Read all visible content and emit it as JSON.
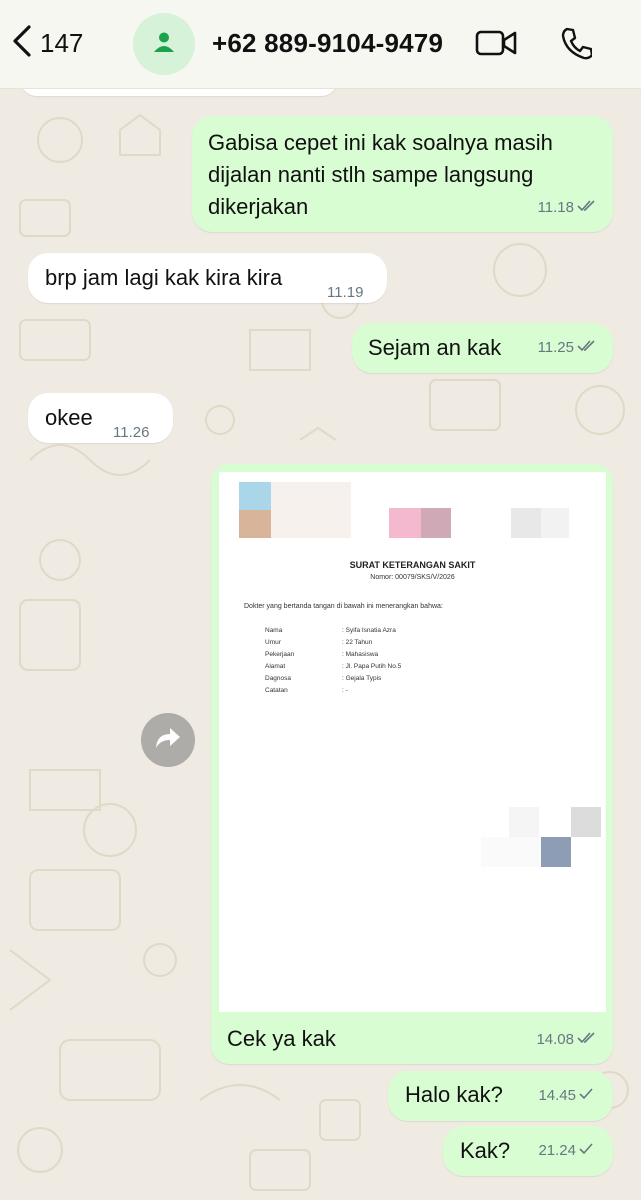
{
  "header": {
    "back_count": "147",
    "contact_name": "+62 889-9104-9479"
  },
  "messages": [
    {
      "text": "Gabisa cepet ini kak soalnya masih dijalan nanti stlh sampe langsung dikerjakan",
      "line1": "Gabisa cepet ini kak soalnya masih",
      "line2": "dijalan nanti stlh sampe langsung",
      "line3": "dikerjakan",
      "time": "11.18",
      "direction": "out",
      "status": "read"
    },
    {
      "text": "brp jam lagi kak kira kira",
      "time": "11.19",
      "direction": "in"
    },
    {
      "text": "Sejam an kak",
      "time": "11.25",
      "direction": "out",
      "status": "read"
    },
    {
      "text": "okee",
      "time": "11.26",
      "direction": "in"
    },
    {
      "text": "Cek ya kak",
      "time": "14.08",
      "direction": "out",
      "status": "read"
    },
    {
      "text": "Halo kak?",
      "time": "14.45",
      "direction": "out",
      "status": "sent"
    },
    {
      "text": "Kak?",
      "time": "21.24",
      "direction": "out",
      "status": "sent"
    }
  ],
  "document": {
    "title": "SURAT KETERANGAN SAKIT",
    "number": "Nomor: 00079/SKS/V/2026",
    "intro": "Dokter yang bertanda tangan di bawah ini menerangkan bahwa:",
    "fields": [
      {
        "label": "Nama",
        "value": ": Syifa Isnatia Azra"
      },
      {
        "label": "Umur",
        "value": ": 22 Tahun"
      },
      {
        "label": "Pekerjaan",
        "value": ": Mahasiswa"
      },
      {
        "label": "Alamat",
        "value": ": Jl. Papa Putih No.5"
      },
      {
        "label": "Dagnosa",
        "value": ": Gejala Typis"
      },
      {
        "label": "Catatan",
        "value": ": -"
      }
    ]
  },
  "icons": {
    "back": "chevron-left-icon",
    "avatar": "person-icon",
    "video": "video-camera-icon",
    "call": "phone-icon",
    "forward": "forward-arrow-icon",
    "read_receipt": "double-check-icon",
    "sent_receipt": "single-check-icon"
  },
  "colors": {
    "background": "#efeae2",
    "incoming_bubble": "#ffffff",
    "outgoing_bubble": "#d9fdd3",
    "avatar_bg": "#d6f2d8",
    "avatar_icon": "#1aa34a",
    "meta_text": "#667781"
  }
}
